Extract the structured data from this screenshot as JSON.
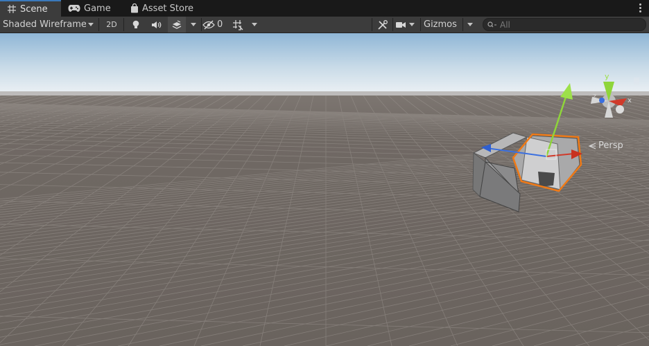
{
  "tabs": [
    {
      "label": "Scene",
      "icon": "grid-icon",
      "active": true
    },
    {
      "label": "Game",
      "icon": "gamepad-icon",
      "active": false
    },
    {
      "label": "Asset Store",
      "icon": "shopping-bag-icon",
      "active": false
    }
  ],
  "toolbar": {
    "draw_mode": "Shaded Wireframe",
    "mode_2d": "2D",
    "hidden_count": "0",
    "gizmos": "Gizmos"
  },
  "search": {
    "placeholder": "All",
    "value": ""
  },
  "viewport": {
    "projection_label": "Persp",
    "axis_labels": {
      "y": "y",
      "x": "x",
      "z": "z"
    },
    "colors": {
      "sky_top": "#8fb6d6",
      "horizon": "#eef2f5",
      "ground": "#6e6762",
      "selection": "#f07a16",
      "axis_x": "#d03a2a",
      "axis_y": "#8fd53a",
      "axis_z": "#3a6fe0",
      "accent_tab": "#3a79bb"
    }
  }
}
